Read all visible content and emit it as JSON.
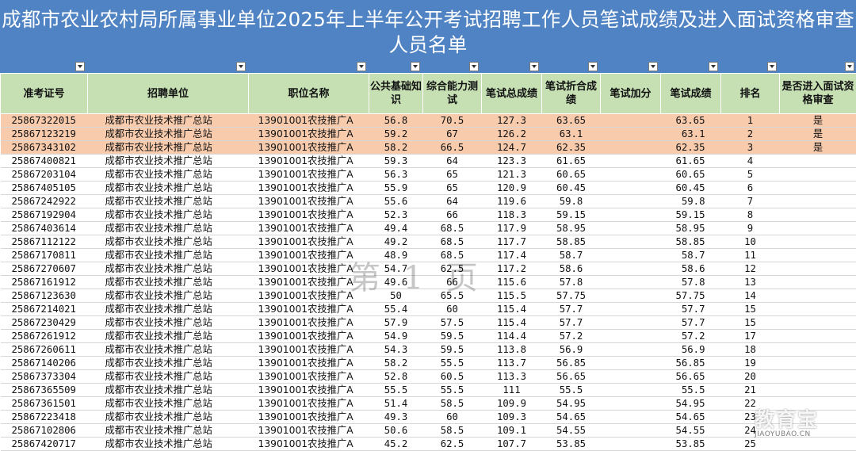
{
  "title": "成都市农业农村局所属事业单位2025年上半年公开考试招聘工作人员笔试成绩及进入面试资格审查人员名单",
  "headers": [
    "准考证号",
    "招聘单位",
    "职位名称",
    "公共基础知识",
    "综合能力测试",
    "笔试总成绩",
    "笔试折合成绩",
    "笔试加分",
    "笔试成绩",
    "排名",
    "是否进入面试资格审查"
  ],
  "rows": [
    [
      "25867322015",
      "成都市农业技术推广总站",
      "13901001农技推广A",
      "56.8",
      "70.5",
      "127.3",
      "63.65",
      "",
      "63.65",
      "1",
      "是"
    ],
    [
      "25867123219",
      "成都市农业技术推广总站",
      "13901001农技推广A",
      "59.2",
      "67",
      "126.2",
      "63.1",
      "",
      "63.1",
      "2",
      "是"
    ],
    [
      "25867343102",
      "成都市农业技术推广总站",
      "13901001农技推广A",
      "58.2",
      "66.5",
      "124.7",
      "62.35",
      "",
      "62.35",
      "3",
      "是"
    ],
    [
      "25867400821",
      "成都市农业技术推广总站",
      "13901001农技推广A",
      "59.3",
      "64",
      "123.3",
      "61.65",
      "",
      "61.65",
      "4",
      ""
    ],
    [
      "25867203104",
      "成都市农业技术推广总站",
      "13901001农技推广A",
      "56.3",
      "65",
      "121.3",
      "60.65",
      "",
      "60.65",
      "5",
      ""
    ],
    [
      "25867405105",
      "成都市农业技术推广总站",
      "13901001农技推广A",
      "55.9",
      "65",
      "120.9",
      "60.45",
      "",
      "60.45",
      "6",
      ""
    ],
    [
      "25867242922",
      "成都市农业技术推广总站",
      "13901001农技推广A",
      "55.6",
      "64",
      "119.6",
      "59.8",
      "",
      "59.8",
      "7",
      ""
    ],
    [
      "25867192904",
      "成都市农业技术推广总站",
      "13901001农技推广A",
      "52.3",
      "66",
      "118.3",
      "59.15",
      "",
      "59.15",
      "8",
      ""
    ],
    [
      "25867403614",
      "成都市农业技术推广总站",
      "13901001农技推广A",
      "49.4",
      "68.5",
      "117.9",
      "58.95",
      "",
      "58.95",
      "9",
      ""
    ],
    [
      "25867112122",
      "成都市农业技术推广总站",
      "13901001农技推广A",
      "49.2",
      "68.5",
      "117.7",
      "58.85",
      "",
      "58.85",
      "10",
      ""
    ],
    [
      "25867170811",
      "成都市农业技术推广总站",
      "13901001农技推广A",
      "48.9",
      "68.5",
      "117.4",
      "58.7",
      "",
      "58.7",
      "11",
      ""
    ],
    [
      "25867270607",
      "成都市农业技术推广总站",
      "13901001农技推广A",
      "54.7",
      "62.5",
      "117.2",
      "58.6",
      "",
      "58.6",
      "12",
      ""
    ],
    [
      "25867161912",
      "成都市农业技术推广总站",
      "13901001农技推广A",
      "49.6",
      "66",
      "115.6",
      "57.8",
      "",
      "57.8",
      "13",
      ""
    ],
    [
      "25867123630",
      "成都市农业技术推广总站",
      "13901001农技推广A",
      "50",
      "65.5",
      "115.5",
      "57.75",
      "",
      "57.75",
      "14",
      ""
    ],
    [
      "25867214021",
      "成都市农业技术推广总站",
      "13901001农技推广A",
      "55.4",
      "60",
      "115.4",
      "57.7",
      "",
      "57.7",
      "15",
      ""
    ],
    [
      "25867230429",
      "成都市农业技术推广总站",
      "13901001农技推广A",
      "57.9",
      "57.5",
      "115.4",
      "57.7",
      "",
      "57.7",
      "15",
      ""
    ],
    [
      "25867261912",
      "成都市农业技术推广总站",
      "13901001农技推广A",
      "54.9",
      "59.5",
      "114.4",
      "57.2",
      "",
      "57.2",
      "17",
      ""
    ],
    [
      "25867260611",
      "成都市农业技术推广总站",
      "13901001农技推广A",
      "54.3",
      "59.5",
      "113.8",
      "56.9",
      "",
      "56.9",
      "18",
      ""
    ],
    [
      "25867140206",
      "成都市农业技术推广总站",
      "13901001农技推广A",
      "58.2",
      "55.5",
      "113.7",
      "56.85",
      "",
      "56.85",
      "19",
      ""
    ],
    [
      "25867373304",
      "成都市农业技术推广总站",
      "13901001农技推广A",
      "52.8",
      "60.5",
      "113.3",
      "56.65",
      "",
      "56.65",
      "20",
      ""
    ],
    [
      "25867365509",
      "成都市农业技术推广总站",
      "13901001农技推广A",
      "55.5",
      "55.5",
      "111",
      "55.5",
      "",
      "55.5",
      "21",
      ""
    ],
    [
      "25867361501",
      "成都市农业技术推广总站",
      "13901001农技推广A",
      "51.4",
      "58.5",
      "109.9",
      "54.95",
      "",
      "54.95",
      "22",
      ""
    ],
    [
      "25867223418",
      "成都市农业技术推广总站",
      "13901001农技推广A",
      "49.3",
      "60",
      "109.3",
      "54.65",
      "",
      "54.65",
      "23",
      ""
    ],
    [
      "25867102806",
      "成都市农业技术推广总站",
      "13901001农技推广A",
      "50.6",
      "58.5",
      "109.1",
      "54.55",
      "",
      "54.55",
      "24",
      ""
    ],
    [
      "25867420717",
      "成都市农业技术推广总站",
      "13901001农技推广A",
      "45.2",
      "62.5",
      "107.7",
      "53.85",
      "",
      "53.85",
      "25",
      ""
    ]
  ],
  "highlight_color": "#f8cbad",
  "header_color": "#c6e0b4",
  "title_bar_color": "#4f83c3",
  "watermark": "第 1 页",
  "logo": {
    "name": "教育宝",
    "url_text": "JIAOYUBAO.CN"
  }
}
